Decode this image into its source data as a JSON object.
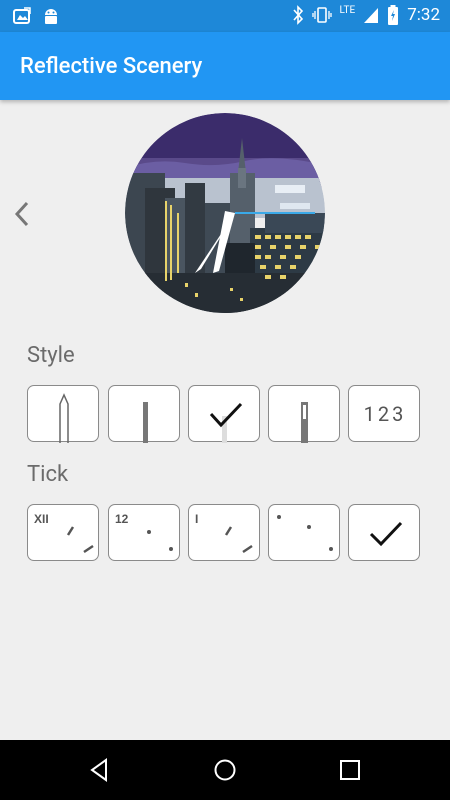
{
  "status_bar": {
    "time": "7:32",
    "network": "LTE"
  },
  "app_bar": {
    "title": "Reflective Scenery"
  },
  "preview": {
    "description_icon": "city-watch-face-preview"
  },
  "style_section": {
    "label": "Style",
    "options": [
      {
        "name": "style-pointed-hand",
        "selected": false
      },
      {
        "name": "style-straight-hand",
        "selected": false
      },
      {
        "name": "style-white-hand",
        "selected": true
      },
      {
        "name": "style-inset-hand",
        "selected": false
      },
      {
        "name": "style-digital",
        "text": "123",
        "selected": false
      }
    ]
  },
  "tick_section": {
    "label": "Tick",
    "options": [
      {
        "name": "tick-roman",
        "text": "XII",
        "selected": false
      },
      {
        "name": "tick-arabic",
        "text": "12",
        "selected": false
      },
      {
        "name": "tick-bar",
        "text": "I",
        "selected": false
      },
      {
        "name": "tick-dots",
        "selected": false
      },
      {
        "name": "tick-none",
        "selected": true
      }
    ]
  },
  "colors": {
    "primary": "#2196f3",
    "status_bar": "#1e88d8",
    "background": "#efefef"
  }
}
